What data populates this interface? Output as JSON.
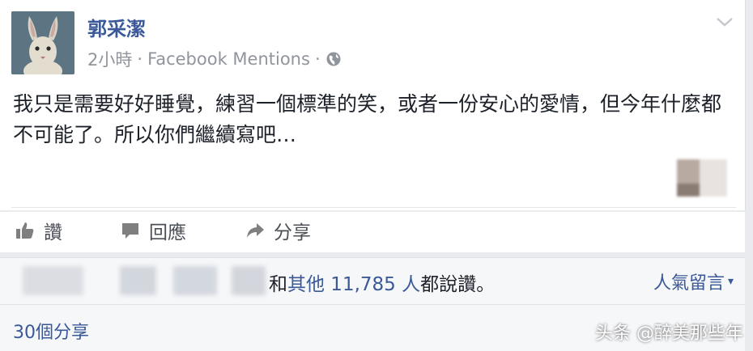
{
  "post": {
    "author": "郭采潔",
    "time": "2小時",
    "separator": "·",
    "source": "Facebook Mentions",
    "separator2": "·",
    "text": "我只是需要好好睡覺，練習一個標準的笑，或者一份安心的愛情，但今年什麼都不可能了。所以你們繼續寫吧…",
    "icons": {
      "avatar": "rabbit-avatar",
      "privacy": "globe-icon",
      "options": "chevron-down-icon"
    }
  },
  "actions": {
    "like_label": "讚",
    "comment_label": "回應",
    "share_label": "分享"
  },
  "likes": {
    "connector": "和",
    "others_link": "其他 11,785 人",
    "suffix": "都說讚。",
    "sort_label": "人氣留言",
    "sort_caret": "▾"
  },
  "shares": {
    "label": "30個分享"
  },
  "watermark": "头条 @醉美那些年",
  "colors": {
    "link": "#3b5998",
    "meta": "#90949c",
    "text": "#1d2129",
    "background": "#e9ebee"
  }
}
